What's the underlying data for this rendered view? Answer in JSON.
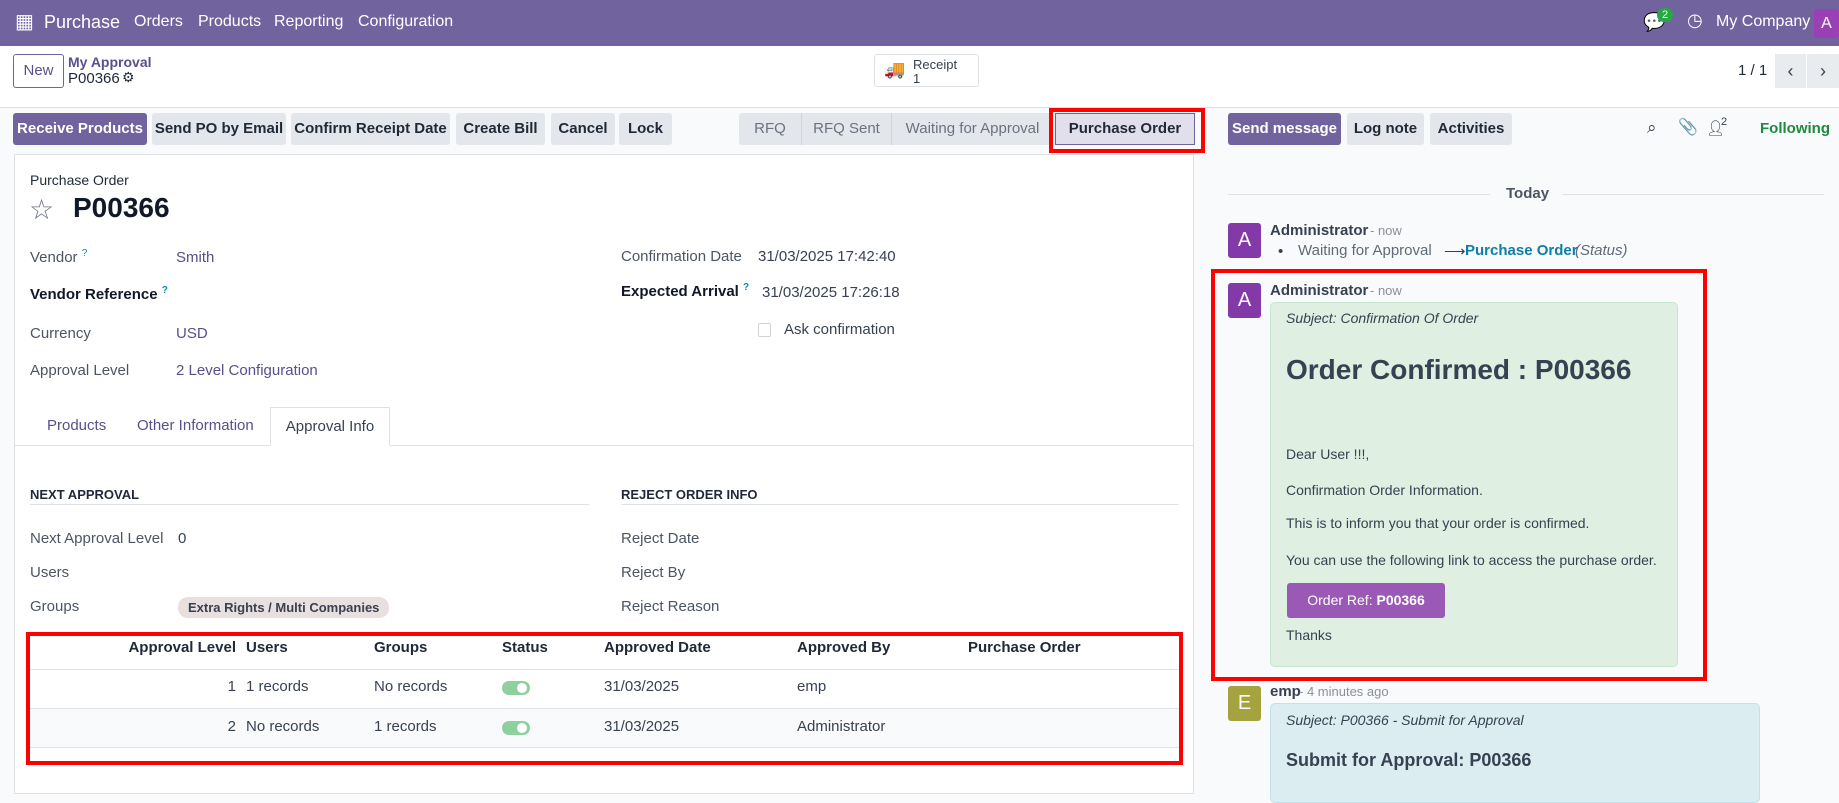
{
  "navbar": {
    "app": "Purchase",
    "menu": [
      "Orders",
      "Products",
      "Reporting",
      "Configuration"
    ],
    "chat_count": "2",
    "company": "My Company",
    "user_initial": "A"
  },
  "control": {
    "new": "New",
    "breadcrumb_parent": "My Approval",
    "record": "P00366",
    "receipt_label": "Receipt",
    "receipt_count": "1",
    "pager": "1 / 1"
  },
  "actions": [
    "Receive Products",
    "Send PO by Email",
    "Confirm Receipt Date",
    "Create Bill",
    "Cancel",
    "Lock"
  ],
  "stages": [
    "RFQ",
    "RFQ Sent",
    "Waiting for Approval",
    "Purchase Order"
  ],
  "form": {
    "type_label": "Purchase Order",
    "name": "P00366",
    "vendor_label": "Vendor",
    "vendor": "Smith",
    "vendor_ref_label": "Vendor Reference",
    "currency_label": "Currency",
    "currency": "USD",
    "approval_level_label": "Approval Level",
    "approval_level": "2 Level Configuration",
    "confirm_date_label": "Confirmation Date",
    "confirm_date": "31/03/2025 17:42:40",
    "expected_label": "Expected Arrival",
    "expected": "31/03/2025 17:26:18",
    "ask_confirm": "Ask confirmation",
    "help": "?"
  },
  "tabs": [
    "Products",
    "Other Information",
    "Approval Info"
  ],
  "approval": {
    "next_title": "NEXT APPROVAL",
    "reject_title": "REJECT ORDER INFO",
    "next_level_label": "Next Approval Level",
    "next_level": "0",
    "users_label": "Users",
    "groups_label": "Groups",
    "group_badge": "Extra Rights / Multi Companies",
    "reject_date": "Reject Date",
    "reject_by": "Reject By",
    "reject_reason": "Reject Reason"
  },
  "table": {
    "headers": [
      "Approval Level",
      "Users",
      "Groups",
      "Status",
      "Approved Date",
      "Approved By",
      "Purchase Order"
    ],
    "rows": [
      {
        "level": "1",
        "users": "1 records",
        "groups": "No records",
        "status": true,
        "date": "31/03/2025",
        "by": "emp",
        "po": ""
      },
      {
        "level": "2",
        "users": "No records",
        "groups": "1 records",
        "status": true,
        "date": "31/03/2025",
        "by": "Administrator",
        "po": ""
      }
    ]
  },
  "chatter": {
    "send": "Send message",
    "log": "Log note",
    "activities": "Activities",
    "followers": "2",
    "following": "Following",
    "today": "Today",
    "m1": {
      "author": "Administrator",
      "time": "- now",
      "initial": "A",
      "from": "Waiting for Approval",
      "arrow": "⟶",
      "to": "Purchase Order",
      "field": "(Status)"
    },
    "m2": {
      "author": "Administrator",
      "time": "- now",
      "initial": "A",
      "subject": "Subject: Confirmation Of Order",
      "heading": "Order Confirmed : P00366",
      "p1": "Dear User !!!,",
      "p2": "Confirmation Order Information.",
      "p3": "This is to inform you that your order is confirmed.",
      "p4": "You can use the following link to access the purchase order.",
      "btn_prefix": "Order Ref: ",
      "btn_ref": "P00366",
      "thanks": "Thanks"
    },
    "m3": {
      "author": "emp",
      "time": "- 4 minutes ago",
      "initial": "E",
      "subject": "Subject: P00366 - Submit for Approval",
      "heading": "Submit for Approval: P00366"
    }
  },
  "colors": {
    "brand": "#71639e",
    "highlight": "#ff0000",
    "green_bubble": "#dff0e2",
    "blue_bubble": "#dcedf2"
  }
}
